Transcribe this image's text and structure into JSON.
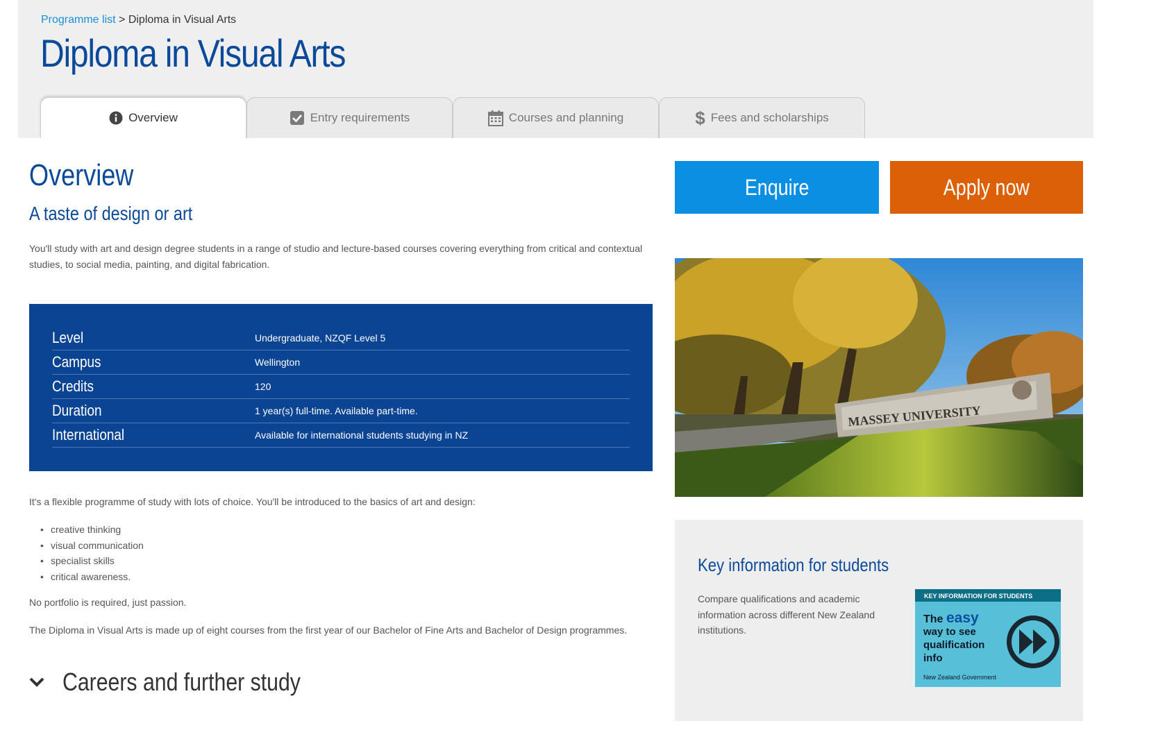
{
  "breadcrumb": {
    "link": "Programme list",
    "separator": " > ",
    "current": "Diploma in Visual Arts"
  },
  "page_title": "Diploma in Visual Arts",
  "tabs": [
    {
      "label": "Overview",
      "icon": "info-icon",
      "active": true
    },
    {
      "label": "Entry requirements",
      "icon": "checkbox-icon",
      "active": false
    },
    {
      "label": "Courses and planning",
      "icon": "calendar-icon",
      "active": false
    },
    {
      "label": "Fees and scholarships",
      "icon": "dollar-icon",
      "active": false
    }
  ],
  "overview": {
    "heading": "Overview",
    "subheading": "A taste of design or art",
    "intro": "You'll study with art and design degree students in a range of studio and lecture-based courses covering everything from critical and contextual studies, to social media, painting, and digital fabrication."
  },
  "info_table": [
    {
      "label": "Level",
      "value": "Undergraduate, NZQF Level 5"
    },
    {
      "label": "Campus",
      "value": "Wellington"
    },
    {
      "label": "Credits",
      "value": "120"
    },
    {
      "label": "Duration",
      "value": "1 year(s) full-time. Available part-time."
    },
    {
      "label": "International",
      "value": "Available for international students studying in NZ"
    }
  ],
  "body": {
    "flexible": "It's a flexible programme of study with lots of choice. You'll be introduced to the basics of art and design:",
    "bullets": [
      "creative thinking",
      "visual communication",
      "specialist skills",
      "critical awareness."
    ],
    "portfolio": "No portfolio is required, just passion.",
    "made_up": "The Diploma in Visual Arts is made up of eight courses from the first year of our Bachelor of Fine Arts and Bachelor of Design programmes."
  },
  "careers": {
    "label": "Careers and further study",
    "icon": "chevron-down-icon"
  },
  "actions": {
    "enquire": "Enquire",
    "apply": "Apply now"
  },
  "campus_sign": "MASSEY UNIVERSITY",
  "key_info": {
    "title": "Key information for students",
    "text": "Compare qualifications and academic information across different New Zealand institutions.",
    "banner": {
      "header": "KEY INFORMATION FOR STUDENTS",
      "line1_a": "The",
      "line1_b": "easy",
      "line2": "way to see",
      "line3": "qualification",
      "line4": "info",
      "footer": "New Zealand Government"
    }
  },
  "colors": {
    "brand_blue": "#0b4a9a",
    "enquire": "#0a8fe3",
    "apply": "#dc6008",
    "info_bg": "#0c4494"
  }
}
